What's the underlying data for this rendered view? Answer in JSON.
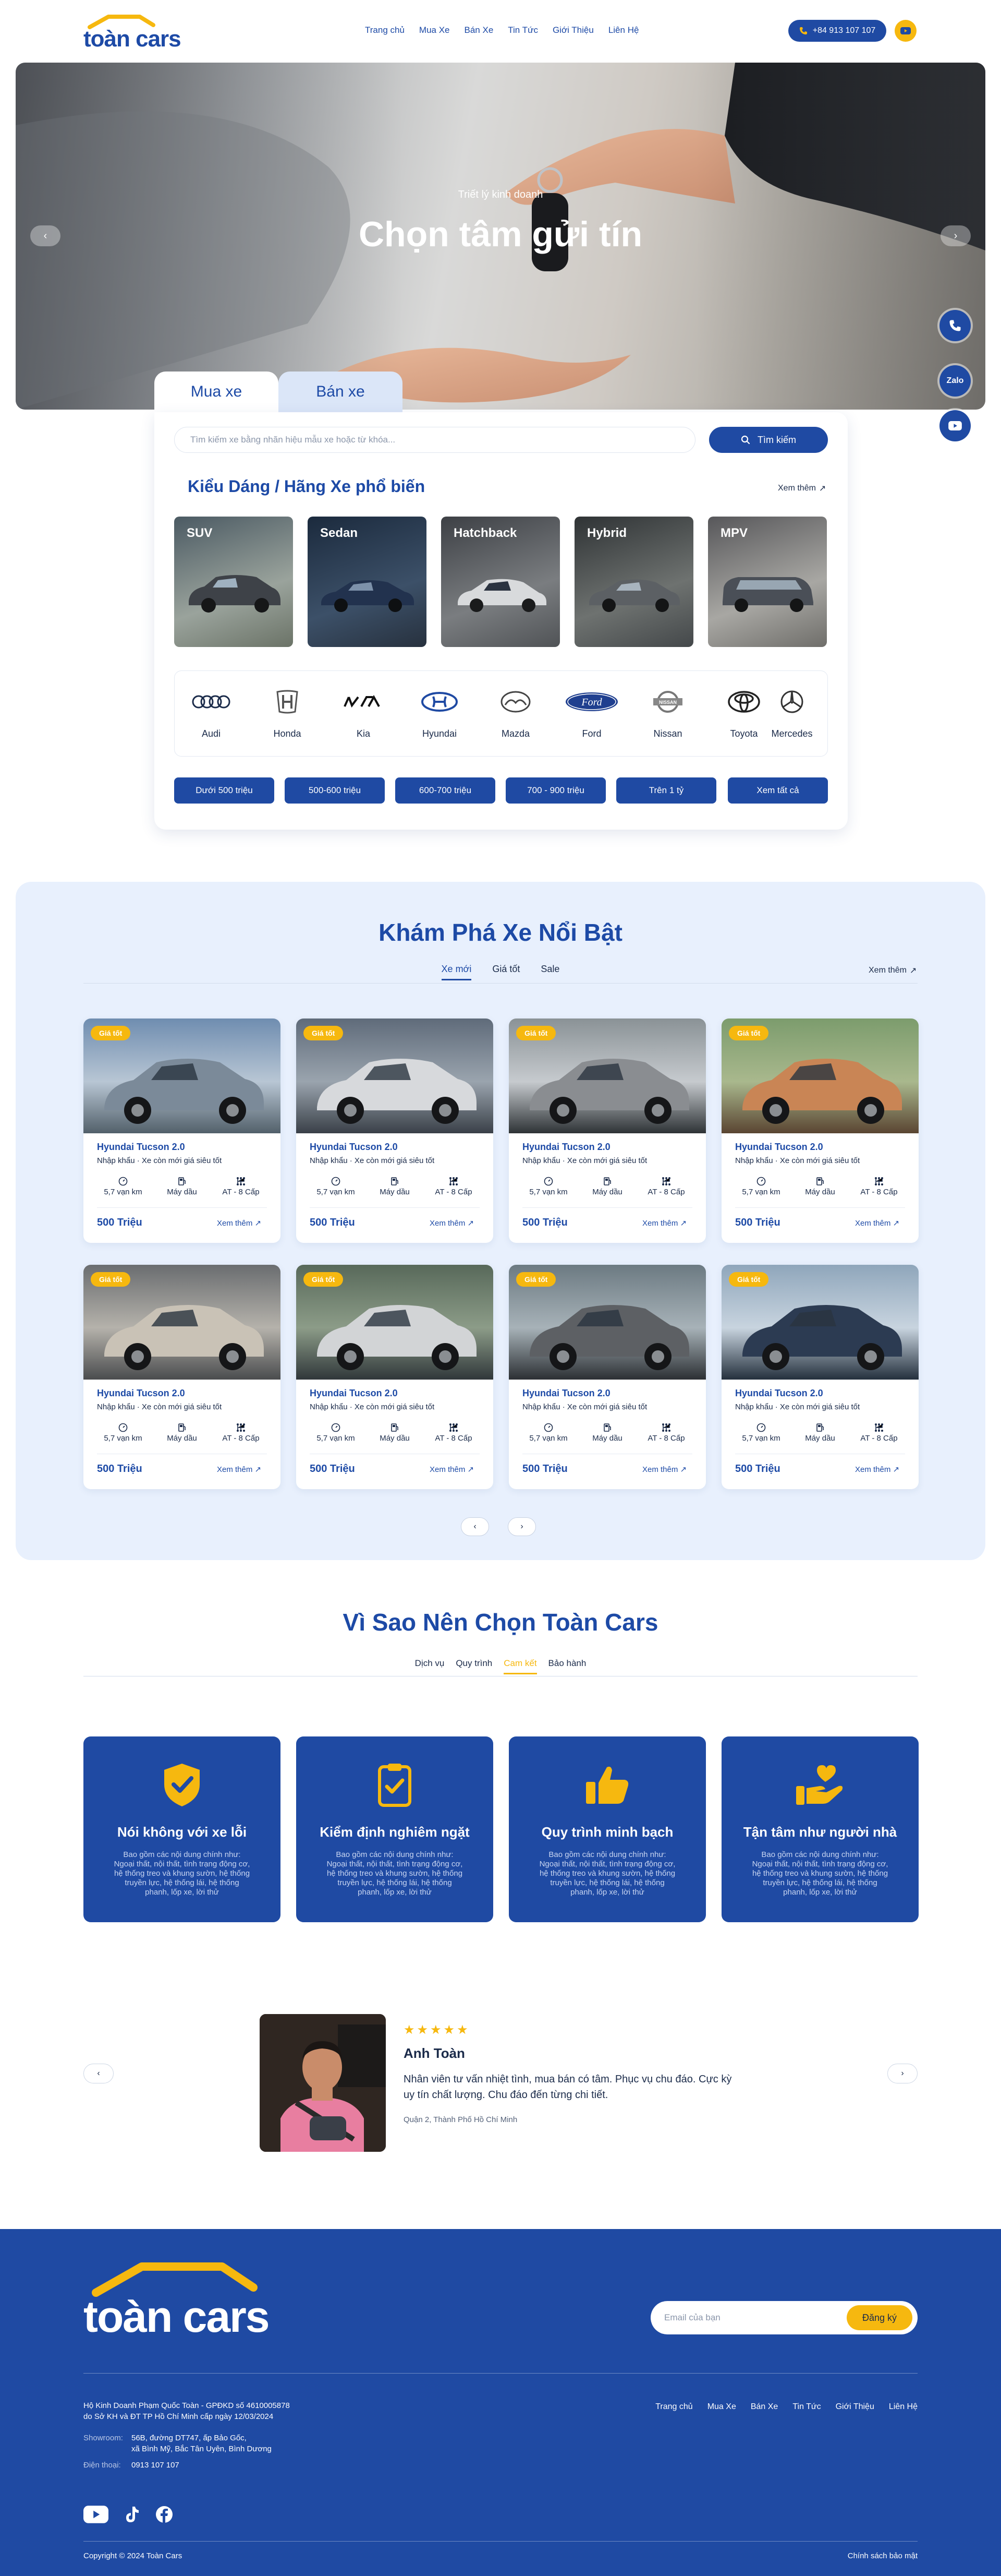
{
  "brand": {
    "logo_text": "toàn cars",
    "accent": "#f6b80f",
    "primary": "#1f4aa3"
  },
  "header": {
    "nav": [
      "Trang chủ",
      "Mua Xe",
      "Bán Xe",
      "Tin Tức",
      "Giới Thiệu",
      "Liên Hệ"
    ],
    "phone": "+84 913 107 107"
  },
  "hero": {
    "subtitle": "Triết lý kinh doanh",
    "title": "Chọn tâm gửi tín",
    "float_buttons": {
      "zalo": "Zalo"
    }
  },
  "search": {
    "tabs": [
      "Mua xe",
      "Bán xe"
    ],
    "placeholder": "Tìm kiếm xe bằng nhãn hiệu mẫu xe hoặc từ khóa...",
    "button": "Tìm kiếm",
    "section_title": "Kiểu Dáng / Hãng Xe phổ biến",
    "see_more": "Xem thêm",
    "body_types": [
      "SUV",
      "Sedan",
      "Hatchback",
      "Hybrid",
      "MPV"
    ],
    "brands": [
      "Audi",
      "Honda",
      "Kia",
      "Hyundai",
      "Mazda",
      "Ford",
      "Nissan",
      "Toyota",
      "Mercedes"
    ],
    "price_ranges": [
      "Dưới 500 triệu",
      "500-600 triệu",
      "600-700 triệu",
      "700 - 900 triệu",
      "Trên 1 tỷ",
      "Xem tất cả"
    ]
  },
  "featured": {
    "title": "Khám Phá Xe Nổi Bật",
    "tabs": [
      "Xe mới",
      "Giá tốt",
      "Sale"
    ],
    "see_more": "Xem thêm",
    "cars": [
      {
        "badge": "Giá tốt",
        "name": "Hyundai Tucson 2.0",
        "desc": "Nhập khẩu  ·  Xe còn mới giá siêu tốt",
        "km": "5,7 vạn km",
        "fuel": "Máy dầu",
        "gear": "AT - 8 Cấp",
        "price": "500 Triệu",
        "more": "Xem thêm"
      },
      {
        "badge": "Giá tốt",
        "name": "Hyundai Tucson 2.0",
        "desc": "Nhập khẩu  ·  Xe còn mới giá siêu tốt",
        "km": "5,7 vạn km",
        "fuel": "Máy dầu",
        "gear": "AT - 8 Cấp",
        "price": "500 Triệu",
        "more": "Xem thêm"
      },
      {
        "badge": "Giá tốt",
        "name": "Hyundai Tucson 2.0",
        "desc": "Nhập khẩu  ·  Xe còn mới giá siêu tốt",
        "km": "5,7 vạn km",
        "fuel": "Máy dầu",
        "gear": "AT - 8 Cấp",
        "price": "500 Triệu",
        "more": "Xem thêm"
      },
      {
        "badge": "Giá tốt",
        "name": "Hyundai Tucson 2.0",
        "desc": "Nhập khẩu  ·  Xe còn mới giá siêu tốt",
        "km": "5,7 vạn km",
        "fuel": "Máy dầu",
        "gear": "AT - 8 Cấp",
        "price": "500 Triệu",
        "more": "Xem thêm"
      },
      {
        "badge": "Giá tốt",
        "name": "Hyundai Tucson 2.0",
        "desc": "Nhập khẩu  ·  Xe còn mới giá siêu tốt",
        "km": "5,7 vạn km",
        "fuel": "Máy dầu",
        "gear": "AT - 8 Cấp",
        "price": "500 Triệu",
        "more": "Xem thêm"
      },
      {
        "badge": "Giá tốt",
        "name": "Hyundai Tucson 2.0",
        "desc": "Nhập khẩu  ·  Xe còn mới giá siêu tốt",
        "km": "5,7 vạn km",
        "fuel": "Máy dầu",
        "gear": "AT - 8 Cấp",
        "price": "500 Triệu",
        "more": "Xem thêm"
      },
      {
        "badge": "Giá tốt",
        "name": "Hyundai Tucson 2.0",
        "desc": "Nhập khẩu  ·  Xe còn mới giá siêu tốt",
        "km": "5,7 vạn km",
        "fuel": "Máy dầu",
        "gear": "AT - 8 Cấp",
        "price": "500 Triệu",
        "more": "Xem thêm"
      },
      {
        "badge": "Giá tốt",
        "name": "Hyundai Tucson 2.0",
        "desc": "Nhập khẩu  ·  Xe còn mới giá siêu tốt",
        "km": "5,7 vạn km",
        "fuel": "Máy dầu",
        "gear": "AT - 8 Cấp",
        "price": "500 Triệu",
        "more": "Xem thêm"
      }
    ]
  },
  "why": {
    "title": "Vì Sao Nên Chọn Toàn Cars",
    "tabs": [
      "Dịch vụ",
      "Quy trình",
      "Cam kết",
      "Bảo hành"
    ],
    "cards": [
      {
        "icon": "shield-check-icon",
        "title": "Nói không với xe lỗi",
        "desc": "Bao gồm các nội dung chính như: Ngoại thất, nội thất, tình trạng động cơ, hệ thống treo và khung sườn, hệ thống truyền lực, hệ thống lái, hệ thống phanh, lốp xe, lời thử"
      },
      {
        "icon": "clipboard-check-icon",
        "title": "Kiểm định nghiêm ngặt",
        "desc": "Bao gồm các nội dung chính như: Ngoại thất, nội thất, tình trạng động cơ, hệ thống treo và khung sườn, hệ thống truyền lực, hệ thống lái, hệ thống phanh, lốp xe, lời thử"
      },
      {
        "icon": "thumbs-up-icon",
        "title": "Quy trình minh bạch",
        "desc": "Bao gồm các nội dung chính như: Ngoại thất, nội thất, tình trạng động cơ, hệ thống treo và khung sườn, hệ thống truyền lực, hệ thống lái, hệ thống phanh, lốp xe, lời thử"
      },
      {
        "icon": "heart-hand-icon",
        "title": "Tận tâm như người nhà",
        "desc": "Bao gồm các nội dung chính như: Ngoại thất, nội thất, tình trạng động cơ, hệ thống treo và khung sườn, hệ thống truyền lực, hệ thống lái, hệ thống phanh, lốp xe, lời thử"
      }
    ]
  },
  "testimonial": {
    "stars": "★★★★★",
    "name": "Anh Toàn",
    "quote": "Nhân viên tư vấn nhiệt tình, mua bán có tâm. Phục vụ chu đáo. Cực kỳ uy tín chất lượng. Chu đáo đến từng chi tiết.",
    "location": "Quận 2, Thành Phố Hồ Chí Minh"
  },
  "footer": {
    "newsletter_placeholder": "Email của bạn",
    "newsletter_button": "Đăng ký",
    "legal_1": "Hộ Kinh Doanh Phạm Quốc Toàn - GPĐKD số 4610005878",
    "legal_2": "do Sở KH và ĐT TP Hồ Chí Minh cấp ngày 12/03/2024",
    "showroom_label": "Showroom:",
    "showroom_1": "56B, đường DT747, ấp Bảo Gốc,",
    "showroom_2": "xã Bình Mỹ, Bắc Tân Uyên, Bình Dương",
    "phone_label": "Điện thoại:",
    "phone": "0913 107 107",
    "nav": [
      "Trang chủ",
      "Mua Xe",
      "Bán Xe",
      "Tin Tức",
      "Giới Thiệu",
      "Liên Hệ"
    ],
    "copyright": "Copyright © 2024 Toàn Cars",
    "policy": "Chính sách bảo mật"
  }
}
